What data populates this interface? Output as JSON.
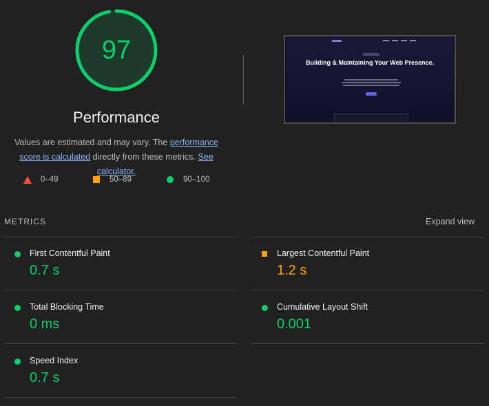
{
  "summary": {
    "score": "97",
    "score_fraction": 0.97,
    "title": "Performance",
    "desc_prefix": "Values are estimated and may vary. The ",
    "desc_link1": "performance score is calculated",
    "desc_middle": " directly from these metrics. ",
    "desc_link2": "See calculator."
  },
  "legend": [
    {
      "label": "0–49",
      "color": "#ff4e42",
      "shape": "triangle"
    },
    {
      "label": "50–89",
      "color": "#ffa400",
      "shape": "square"
    },
    {
      "label": "90–100",
      "color": "#0cce6b",
      "shape": "circle"
    }
  ],
  "screenshot": {
    "headline": "Building & Maintaining Your Web Presence."
  },
  "metrics": {
    "heading": "METRICS",
    "expand_label": "Expand view",
    "items": [
      {
        "name": "First Contentful Paint",
        "value": "0.7 s",
        "status": "good"
      },
      {
        "name": "Largest Contentful Paint",
        "value": "1.2 s",
        "status": "average"
      },
      {
        "name": "Total Blocking Time",
        "value": "0 ms",
        "status": "good"
      },
      {
        "name": "Cumulative Layout Shift",
        "value": "0.001",
        "status": "good"
      },
      {
        "name": "Speed Index",
        "value": "0.7 s",
        "status": "good"
      }
    ]
  },
  "colors": {
    "good": "#0cce6b",
    "average": "#ffa400",
    "poor": "#ff4e42",
    "link": "#8ab4f8"
  }
}
